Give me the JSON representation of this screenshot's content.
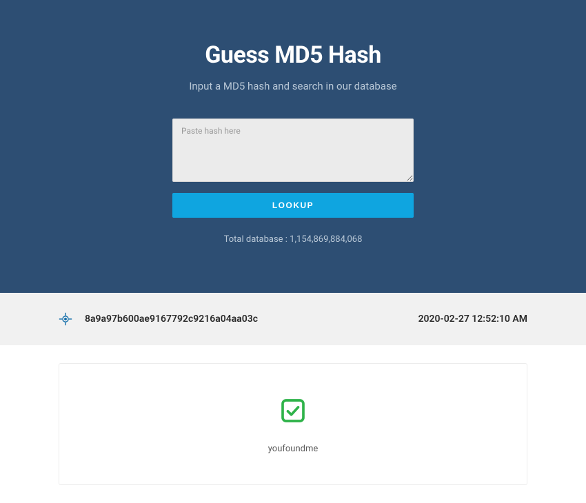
{
  "hero": {
    "title": "Guess MD5 Hash",
    "subtitle": "Input a MD5 hash and search in our database",
    "input_placeholder": "Paste hash here",
    "input_value": "",
    "button_label": "LOOKUP",
    "stats_label": "Total database : 1,154,869,884,068"
  },
  "result": {
    "hash": "8a9a97b600ae9167792c9216a04aa03c",
    "timestamp": "2020-02-27 12:52:10 AM",
    "found_text": "youfoundme"
  }
}
